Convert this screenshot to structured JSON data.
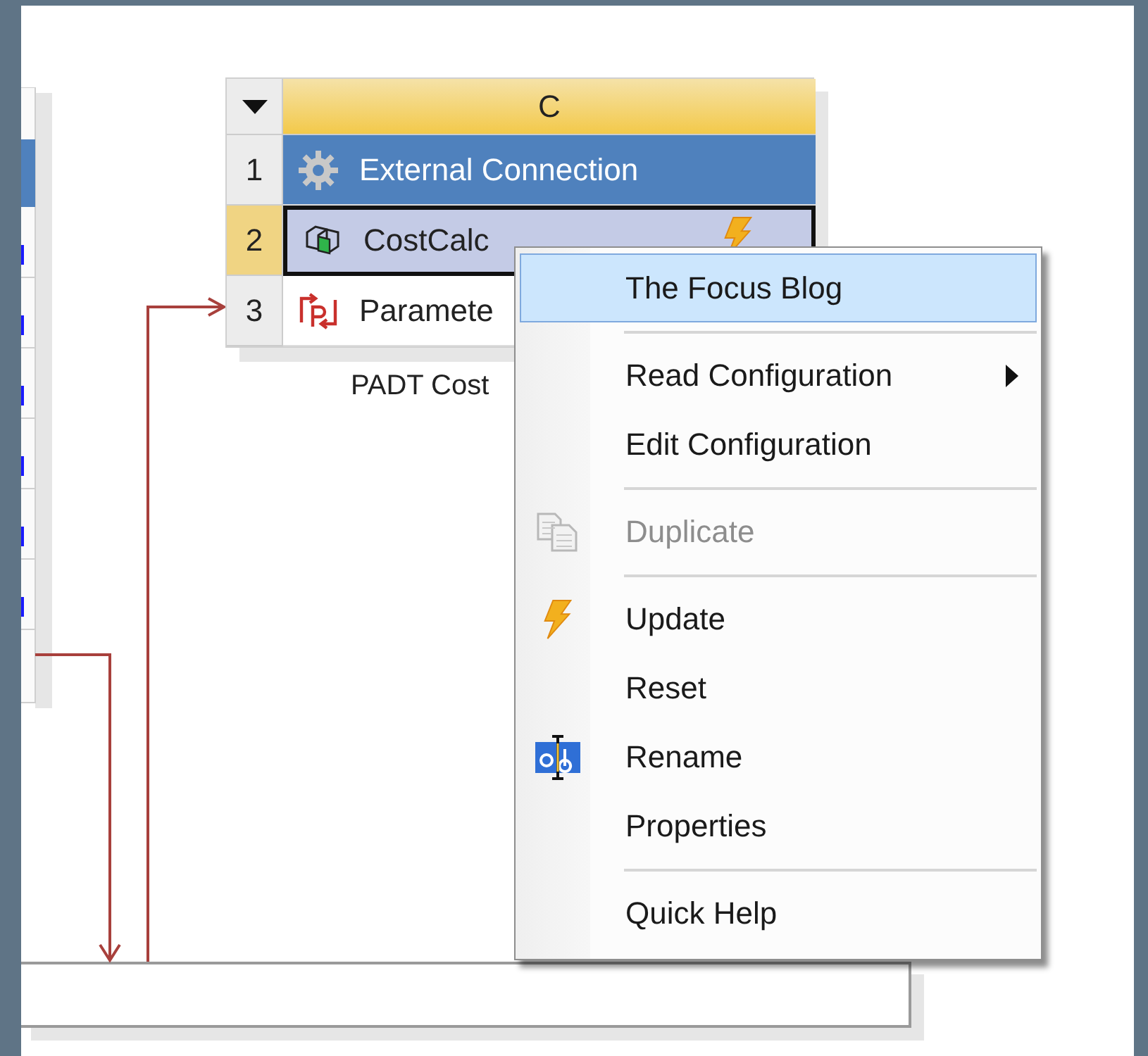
{
  "system": {
    "header": "C",
    "caption": "PADT Cost",
    "rows": [
      {
        "number": "1",
        "label": "External Connection",
        "kind": "title",
        "selected": false,
        "needs_update": false
      },
      {
        "number": "2",
        "label": "CostCalc",
        "kind": "component",
        "selected": true,
        "needs_update": true
      },
      {
        "number": "3",
        "label": "Paramete",
        "kind": "parameters",
        "selected": false
      }
    ]
  },
  "context_menu": {
    "items": [
      {
        "kind": "item",
        "label": "The Focus Blog",
        "selected": true,
        "disabled": false,
        "submenu": false
      },
      {
        "kind": "separator"
      },
      {
        "kind": "item",
        "label": "Read Configuration",
        "selected": false,
        "disabled": false,
        "submenu": true
      },
      {
        "kind": "item",
        "label": "Edit Configuration",
        "selected": false,
        "disabled": false,
        "submenu": false
      },
      {
        "kind": "separator"
      },
      {
        "kind": "duplicate",
        "label": "Duplicate",
        "selected": false,
        "disabled": true,
        "submenu": false
      },
      {
        "kind": "separator"
      },
      {
        "kind": "update",
        "label": "Update",
        "selected": false,
        "disabled": false,
        "submenu": false
      },
      {
        "kind": "item",
        "label": "Reset",
        "selected": false,
        "disabled": false,
        "submenu": false
      },
      {
        "kind": "rename",
        "label": "Rename",
        "selected": false,
        "disabled": false,
        "submenu": false
      },
      {
        "kind": "item",
        "label": "Properties",
        "selected": false,
        "disabled": false,
        "submenu": false
      },
      {
        "kind": "separator"
      },
      {
        "kind": "item",
        "label": "Quick Help",
        "selected": false,
        "disabled": false,
        "submenu": false
      }
    ]
  }
}
